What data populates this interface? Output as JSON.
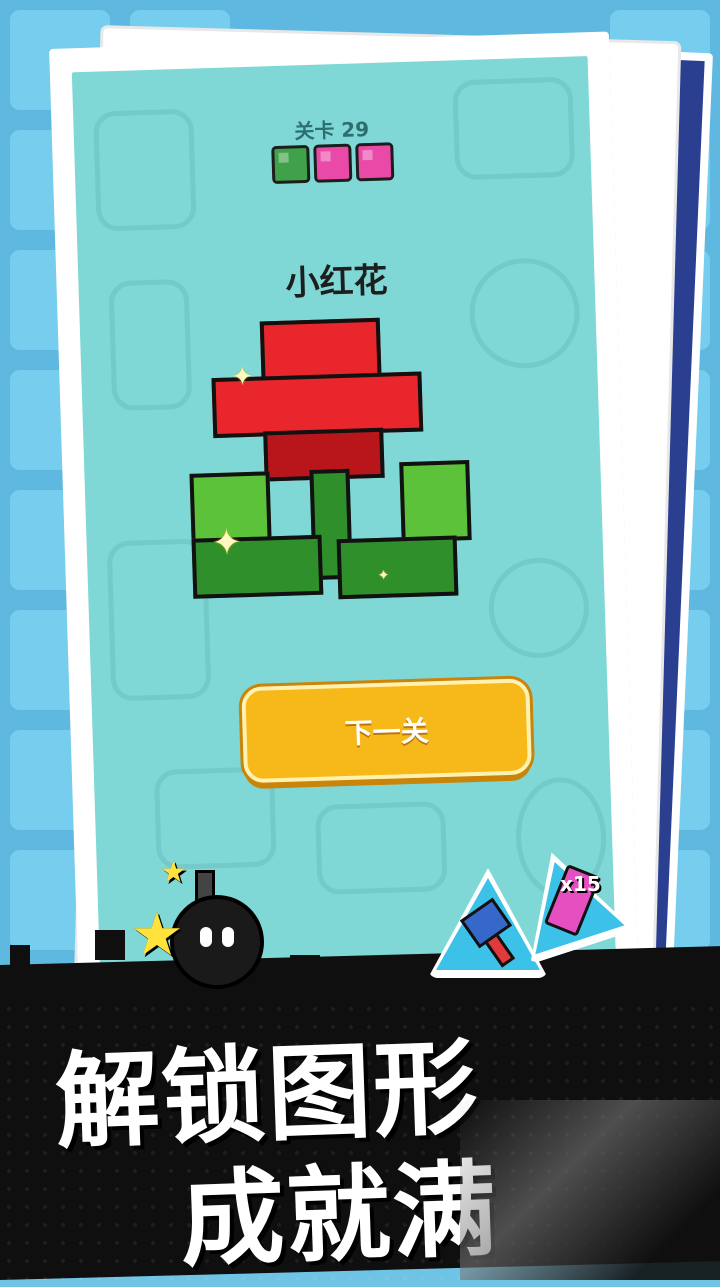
{
  "level": {
    "label": "关卡 29"
  },
  "progress": {
    "cubes": [
      "green",
      "pink",
      "pink"
    ]
  },
  "puzzle": {
    "title": "小红花"
  },
  "actions": {
    "next_label": "下一关"
  },
  "tools": {
    "marker_count": "x15"
  },
  "promo": {
    "line1": "解锁图形",
    "line2": "成就满"
  },
  "colors": {
    "accent": "#f7b91a",
    "card_bg": "#7fd8d6",
    "flower_red": "#e8262b",
    "leaf_green": "#2f8f2a"
  }
}
